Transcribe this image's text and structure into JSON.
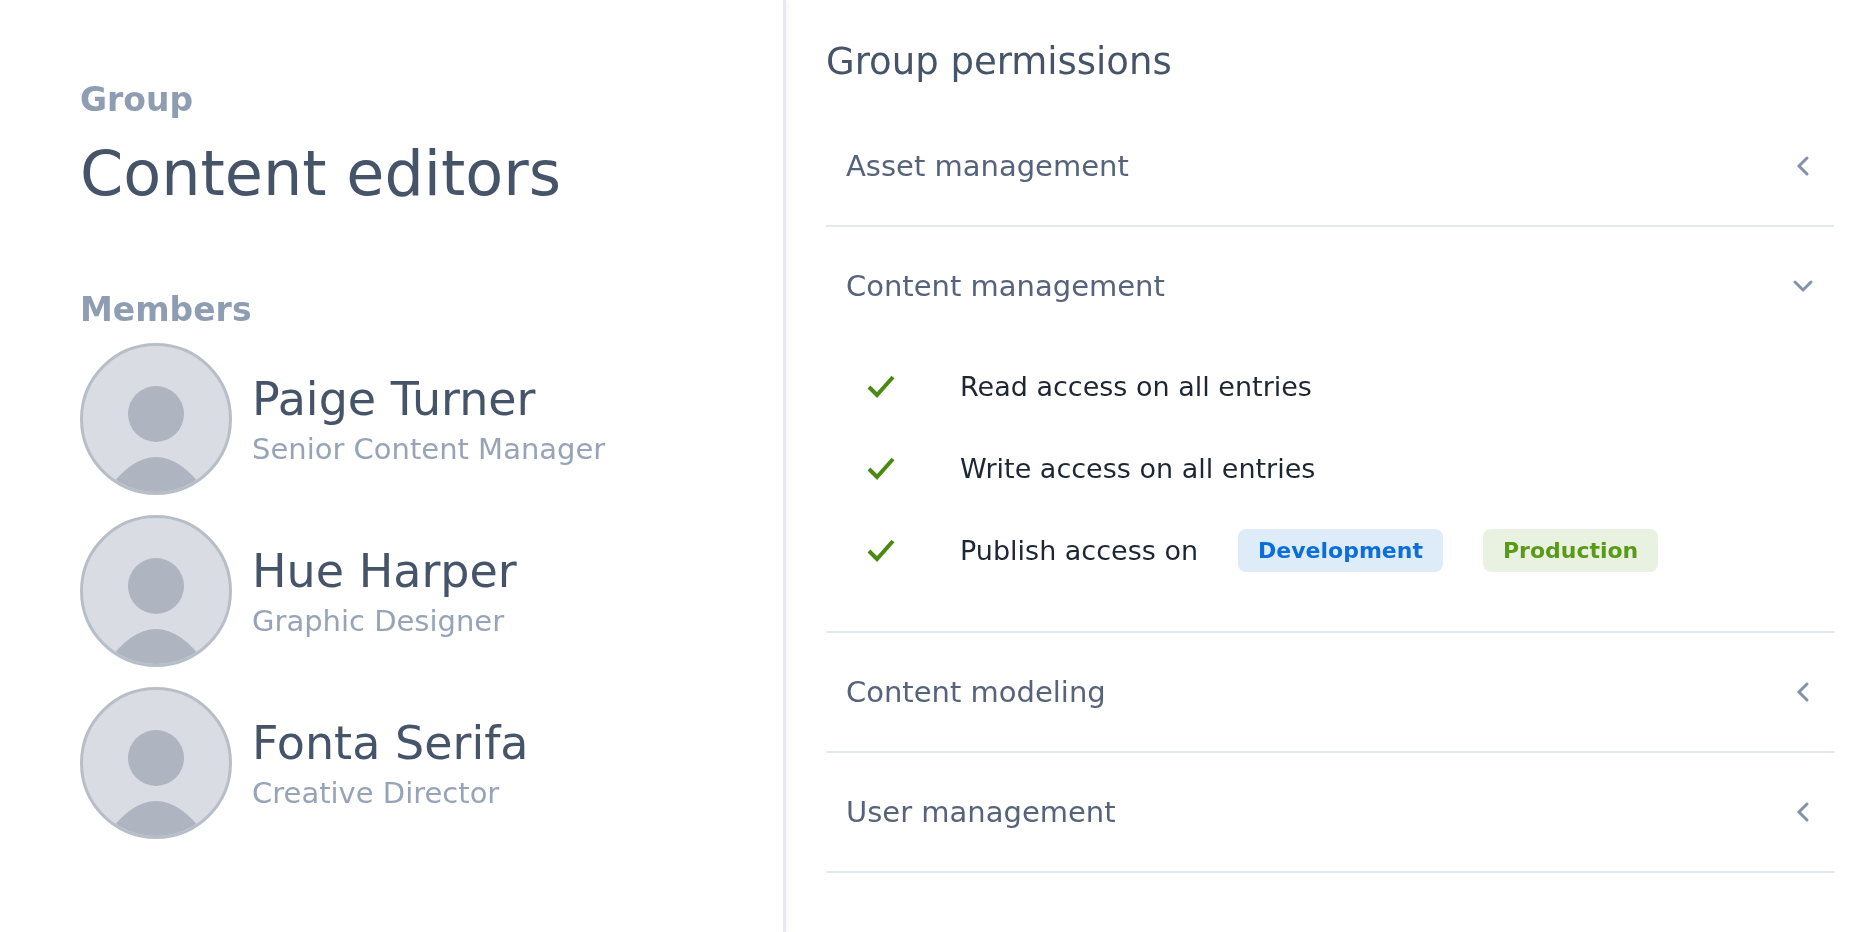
{
  "group": {
    "label": "Group",
    "title": "Content editors"
  },
  "members": {
    "label": "Members",
    "items": [
      {
        "name": "Paige Turner",
        "role": "Senior Content Manager"
      },
      {
        "name": "Hue Harper",
        "role": "Graphic Designer"
      },
      {
        "name": "Fonta Serifa",
        "role": "Creative Director"
      }
    ]
  },
  "permissions": {
    "title": "Group permissions",
    "sections": [
      {
        "label": "Asset management",
        "expanded": false
      },
      {
        "label": "Content management",
        "expanded": true,
        "items": [
          {
            "text": "Read access on all entries",
            "granted": true
          },
          {
            "text": "Write access on all entries",
            "granted": true
          },
          {
            "text": "Publish access on",
            "granted": true,
            "tags": [
              {
                "label": "Development",
                "color": "#0a6fdb"
              },
              {
                "label": "Production",
                "color": "#5a9a1a"
              }
            ]
          }
        ]
      },
      {
        "label": "Content modeling",
        "expanded": false
      },
      {
        "label": "User management",
        "expanded": false
      }
    ]
  }
}
